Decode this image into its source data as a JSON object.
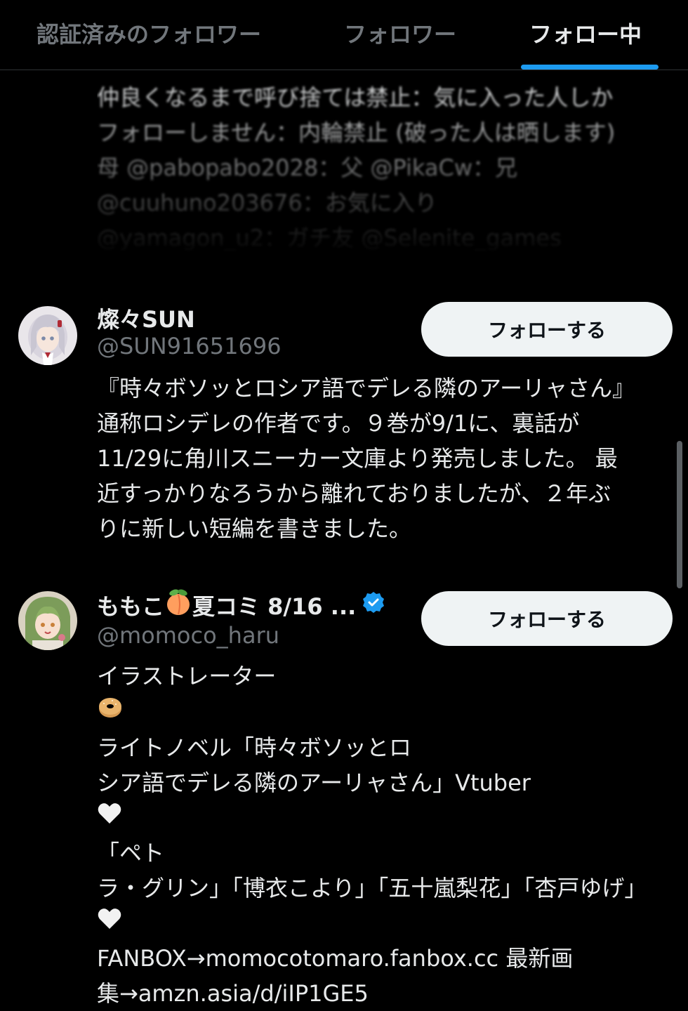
{
  "tabs": [
    {
      "label": "認証済みのフォロワー",
      "active": false
    },
    {
      "label": "フォロワー",
      "active": false
    },
    {
      "label": "フォロー中",
      "active": true
    }
  ],
  "colors": {
    "background": "#000000",
    "text": "#e7e9ea",
    "secondary": "#71767b",
    "accent": "#1d9bf0",
    "button_bg": "#eff3f4"
  },
  "previous_bio_lines": [
    "仲良くなるまで呼び捨ては禁止：気に入った人しか",
    "フォローしません：内輪禁止 (破った人は晒します)",
    "母 @pabopabo2028：父 @PikaCw：兄",
    "@cuuhuno203676：お気に入り",
    "@yamagon_u2：ガチ友 @Selenite_games"
  ],
  "users": [
    {
      "name": "燦々SUN",
      "handle": "@SUN91651696",
      "follow_label": "フォローする",
      "verified": false,
      "avatar_icon": "avatar-girl-white-hair",
      "bio_lines": [
        "『時々ボソッとロシア語でデレる隣のアーリャさん』",
        "通称ロシデレの作者です。９巻が9/1に、裏話が",
        "11/29に角川スニーカー文庫より発売しました。 最",
        "近すっかりなろうから離れておりましたが、２年ぶ",
        "りに新しい短編を書きました。"
      ]
    },
    {
      "name_before_emoji": "ももこ",
      "name_after_emoji": "夏コミ 8/16 ...",
      "name_emoji_icon": "peach-icon",
      "handle": "@momoco_haru",
      "follow_label": "フォローする",
      "verified": true,
      "avatar_icon": "avatar-girl-green-hair",
      "bio_line1_a": "イラストレーター",
      "bio_line1_b": "ライトノベル「時々ボソッとロ",
      "bio_line1_emoji_icon": "bagel-icon",
      "bio_line2_a": "シア語でデレる隣のアーリャさん」Vtuber",
      "bio_line2_b": "「ペト",
      "bio_line2_emoji_icon": "white-heart-icon",
      "bio_line3": "ラ・グリン」「博衣こより」「五十嵐梨花」「杏戸ゆげ」",
      "bio_line4_b": "FANBOX→momocotomaro.fanbox.cc 最新画",
      "bio_line4_emoji_icon": "white-heart-icon",
      "bio_line5": "集→amzn.asia/d/iIP1GE5"
    }
  ]
}
